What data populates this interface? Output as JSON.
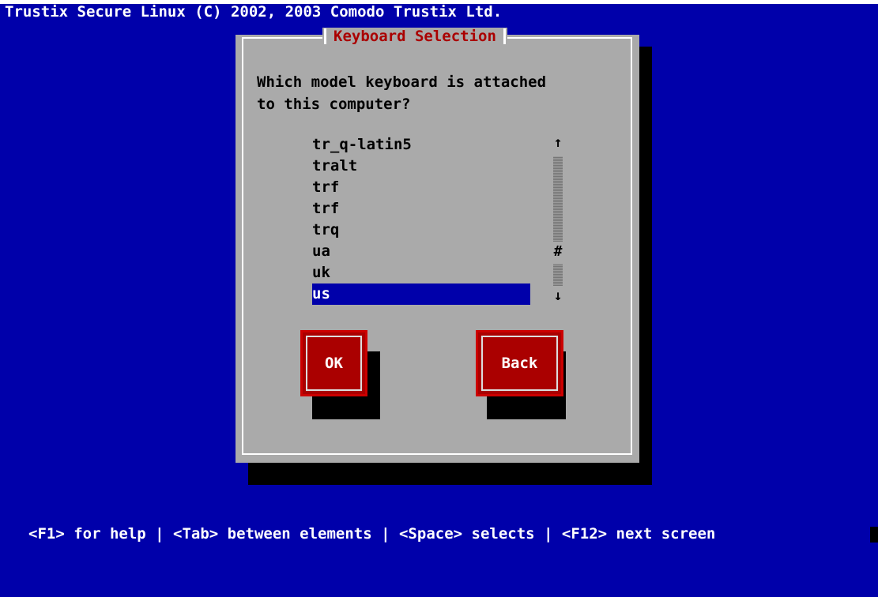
{
  "root": {
    "title": "Trustix Secure Linux (C) 2002, 2003 Comodo Trustix Ltd."
  },
  "dialog": {
    "title": "Keyboard Selection",
    "prompt": "Which model keyboard is attached\nto this computer?",
    "list": {
      "items": [
        "tr_q-latin5",
        "tralt",
        "trf",
        "trf",
        "trq",
        "ua",
        "uk",
        "us"
      ],
      "selected": "us",
      "scroll": {
        "up_arrow_icon": "arrow-up-icon",
        "down_arrow_icon": "arrow-down-icon",
        "thumb": "#"
      }
    },
    "buttons": {
      "ok": "OK",
      "back": "Back"
    }
  },
  "status_bar": {
    "text": "<F1> for help | <Tab> between elements | <Space> selects | <F12> next screen"
  },
  "colors": {
    "background": "#0000aa",
    "dialog": "#aaaaaa",
    "title": "#aa0000",
    "button": "#aa0000",
    "selection": "#0000aa"
  }
}
